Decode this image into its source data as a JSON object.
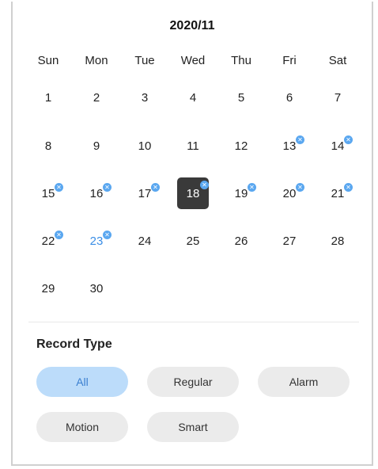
{
  "calendar": {
    "title": "2020/11",
    "weekdays": [
      "Sun",
      "Mon",
      "Tue",
      "Wed",
      "Thu",
      "Fri",
      "Sat"
    ],
    "days": [
      {
        "label": "1",
        "has_record": false
      },
      {
        "label": "2",
        "has_record": false
      },
      {
        "label": "3",
        "has_record": false
      },
      {
        "label": "4",
        "has_record": false
      },
      {
        "label": "5",
        "has_record": false
      },
      {
        "label": "6",
        "has_record": false
      },
      {
        "label": "7",
        "has_record": false
      },
      {
        "label": "8",
        "has_record": false
      },
      {
        "label": "9",
        "has_record": false
      },
      {
        "label": "10",
        "has_record": false
      },
      {
        "label": "11",
        "has_record": false
      },
      {
        "label": "12",
        "has_record": false
      },
      {
        "label": "13",
        "has_record": true
      },
      {
        "label": "14",
        "has_record": true
      },
      {
        "label": "15",
        "has_record": true
      },
      {
        "label": "16",
        "has_record": true
      },
      {
        "label": "17",
        "has_record": true
      },
      {
        "label": "18",
        "has_record": true,
        "selected": true
      },
      {
        "label": "19",
        "has_record": true
      },
      {
        "label": "20",
        "has_record": true
      },
      {
        "label": "21",
        "has_record": true
      },
      {
        "label": "22",
        "has_record": true
      },
      {
        "label": "23",
        "has_record": true,
        "today": true
      },
      {
        "label": "24",
        "has_record": false
      },
      {
        "label": "25",
        "has_record": false
      },
      {
        "label": "26",
        "has_record": false
      },
      {
        "label": "27",
        "has_record": false
      },
      {
        "label": "28",
        "has_record": false
      },
      {
        "label": "29",
        "has_record": false
      },
      {
        "label": "30",
        "has_record": false
      }
    ],
    "record_badge_icon": "record-dot-icon"
  },
  "record_type": {
    "title": "Record Type",
    "options": [
      "All",
      "Regular",
      "Alarm",
      "Motion",
      "Smart"
    ],
    "selected": "All"
  },
  "colors": {
    "accent": "#3a8ee6",
    "badge": "#5aa7f0",
    "selected_day_bg": "#3a3a3a",
    "active_chip_bg": "#bcdcfa",
    "chip_bg": "#ebebeb"
  }
}
